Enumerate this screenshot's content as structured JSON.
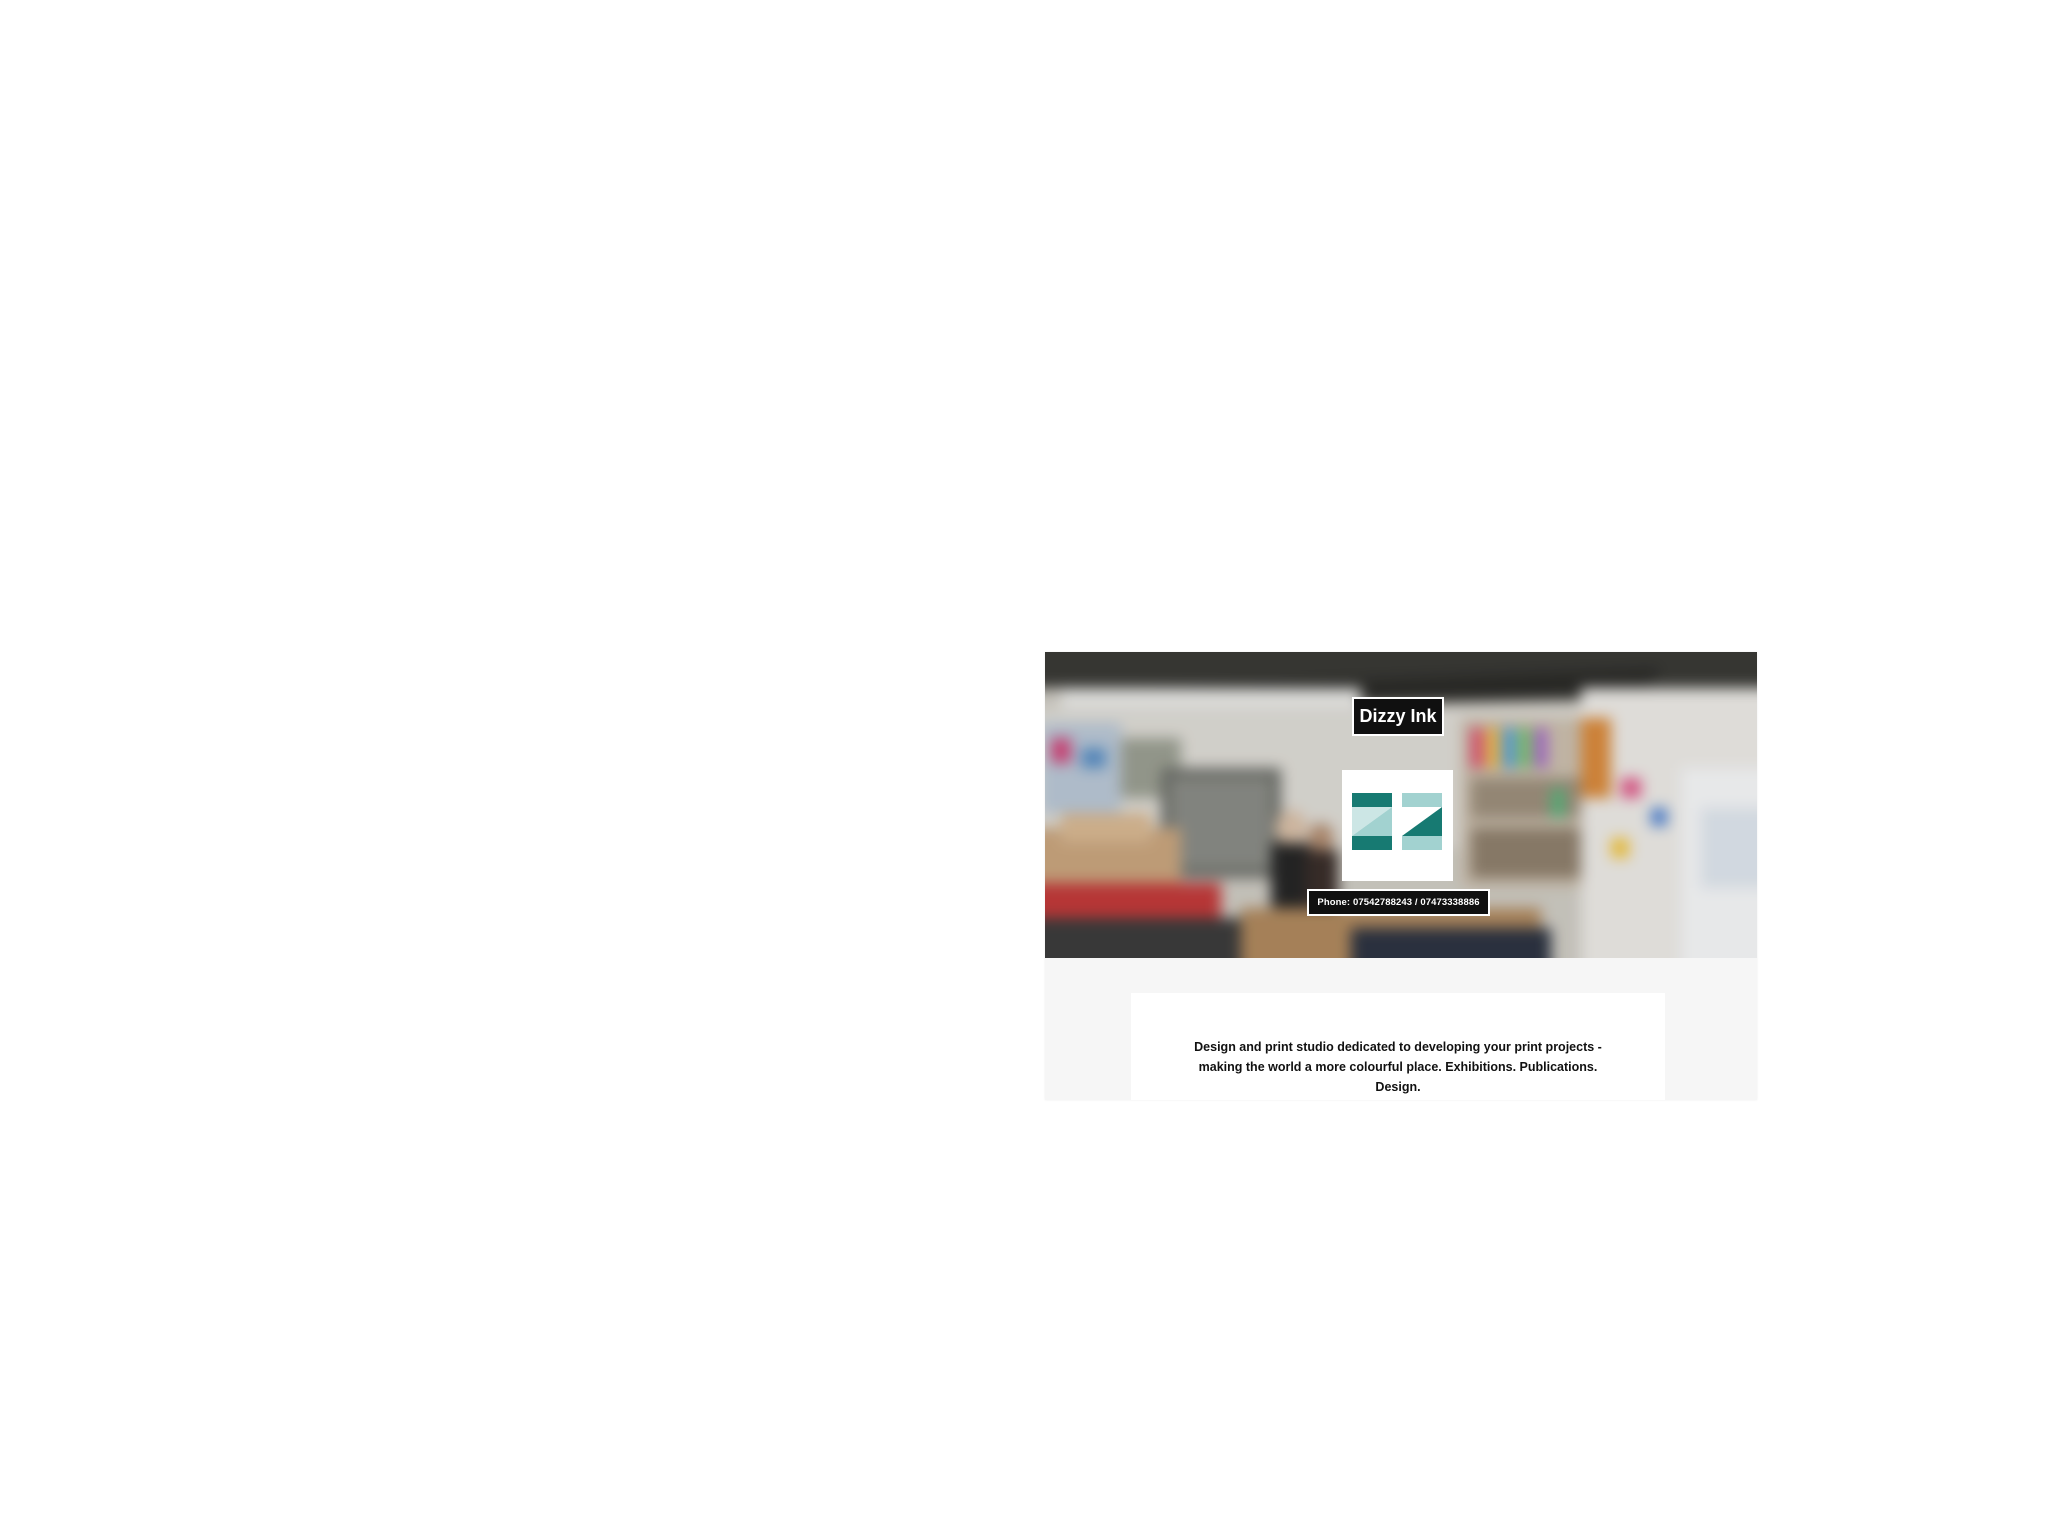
{
  "hero": {
    "image_icon": "studio-photo",
    "title": "Dizzy Ink",
    "logo_icon": "dizzy-ink-logo",
    "phone": "Phone: 07542788243 / 07473338886"
  },
  "intro": {
    "tagline": "Design and print studio dedicated to developing your print projects - making the world a more colourful place. Exhibitions. Publications. Design."
  },
  "colors": {
    "logo_dark": "#177a72",
    "logo_light": "#a2d2d0",
    "label_bg": "#101010",
    "page_bg": "#f6f6f6"
  }
}
